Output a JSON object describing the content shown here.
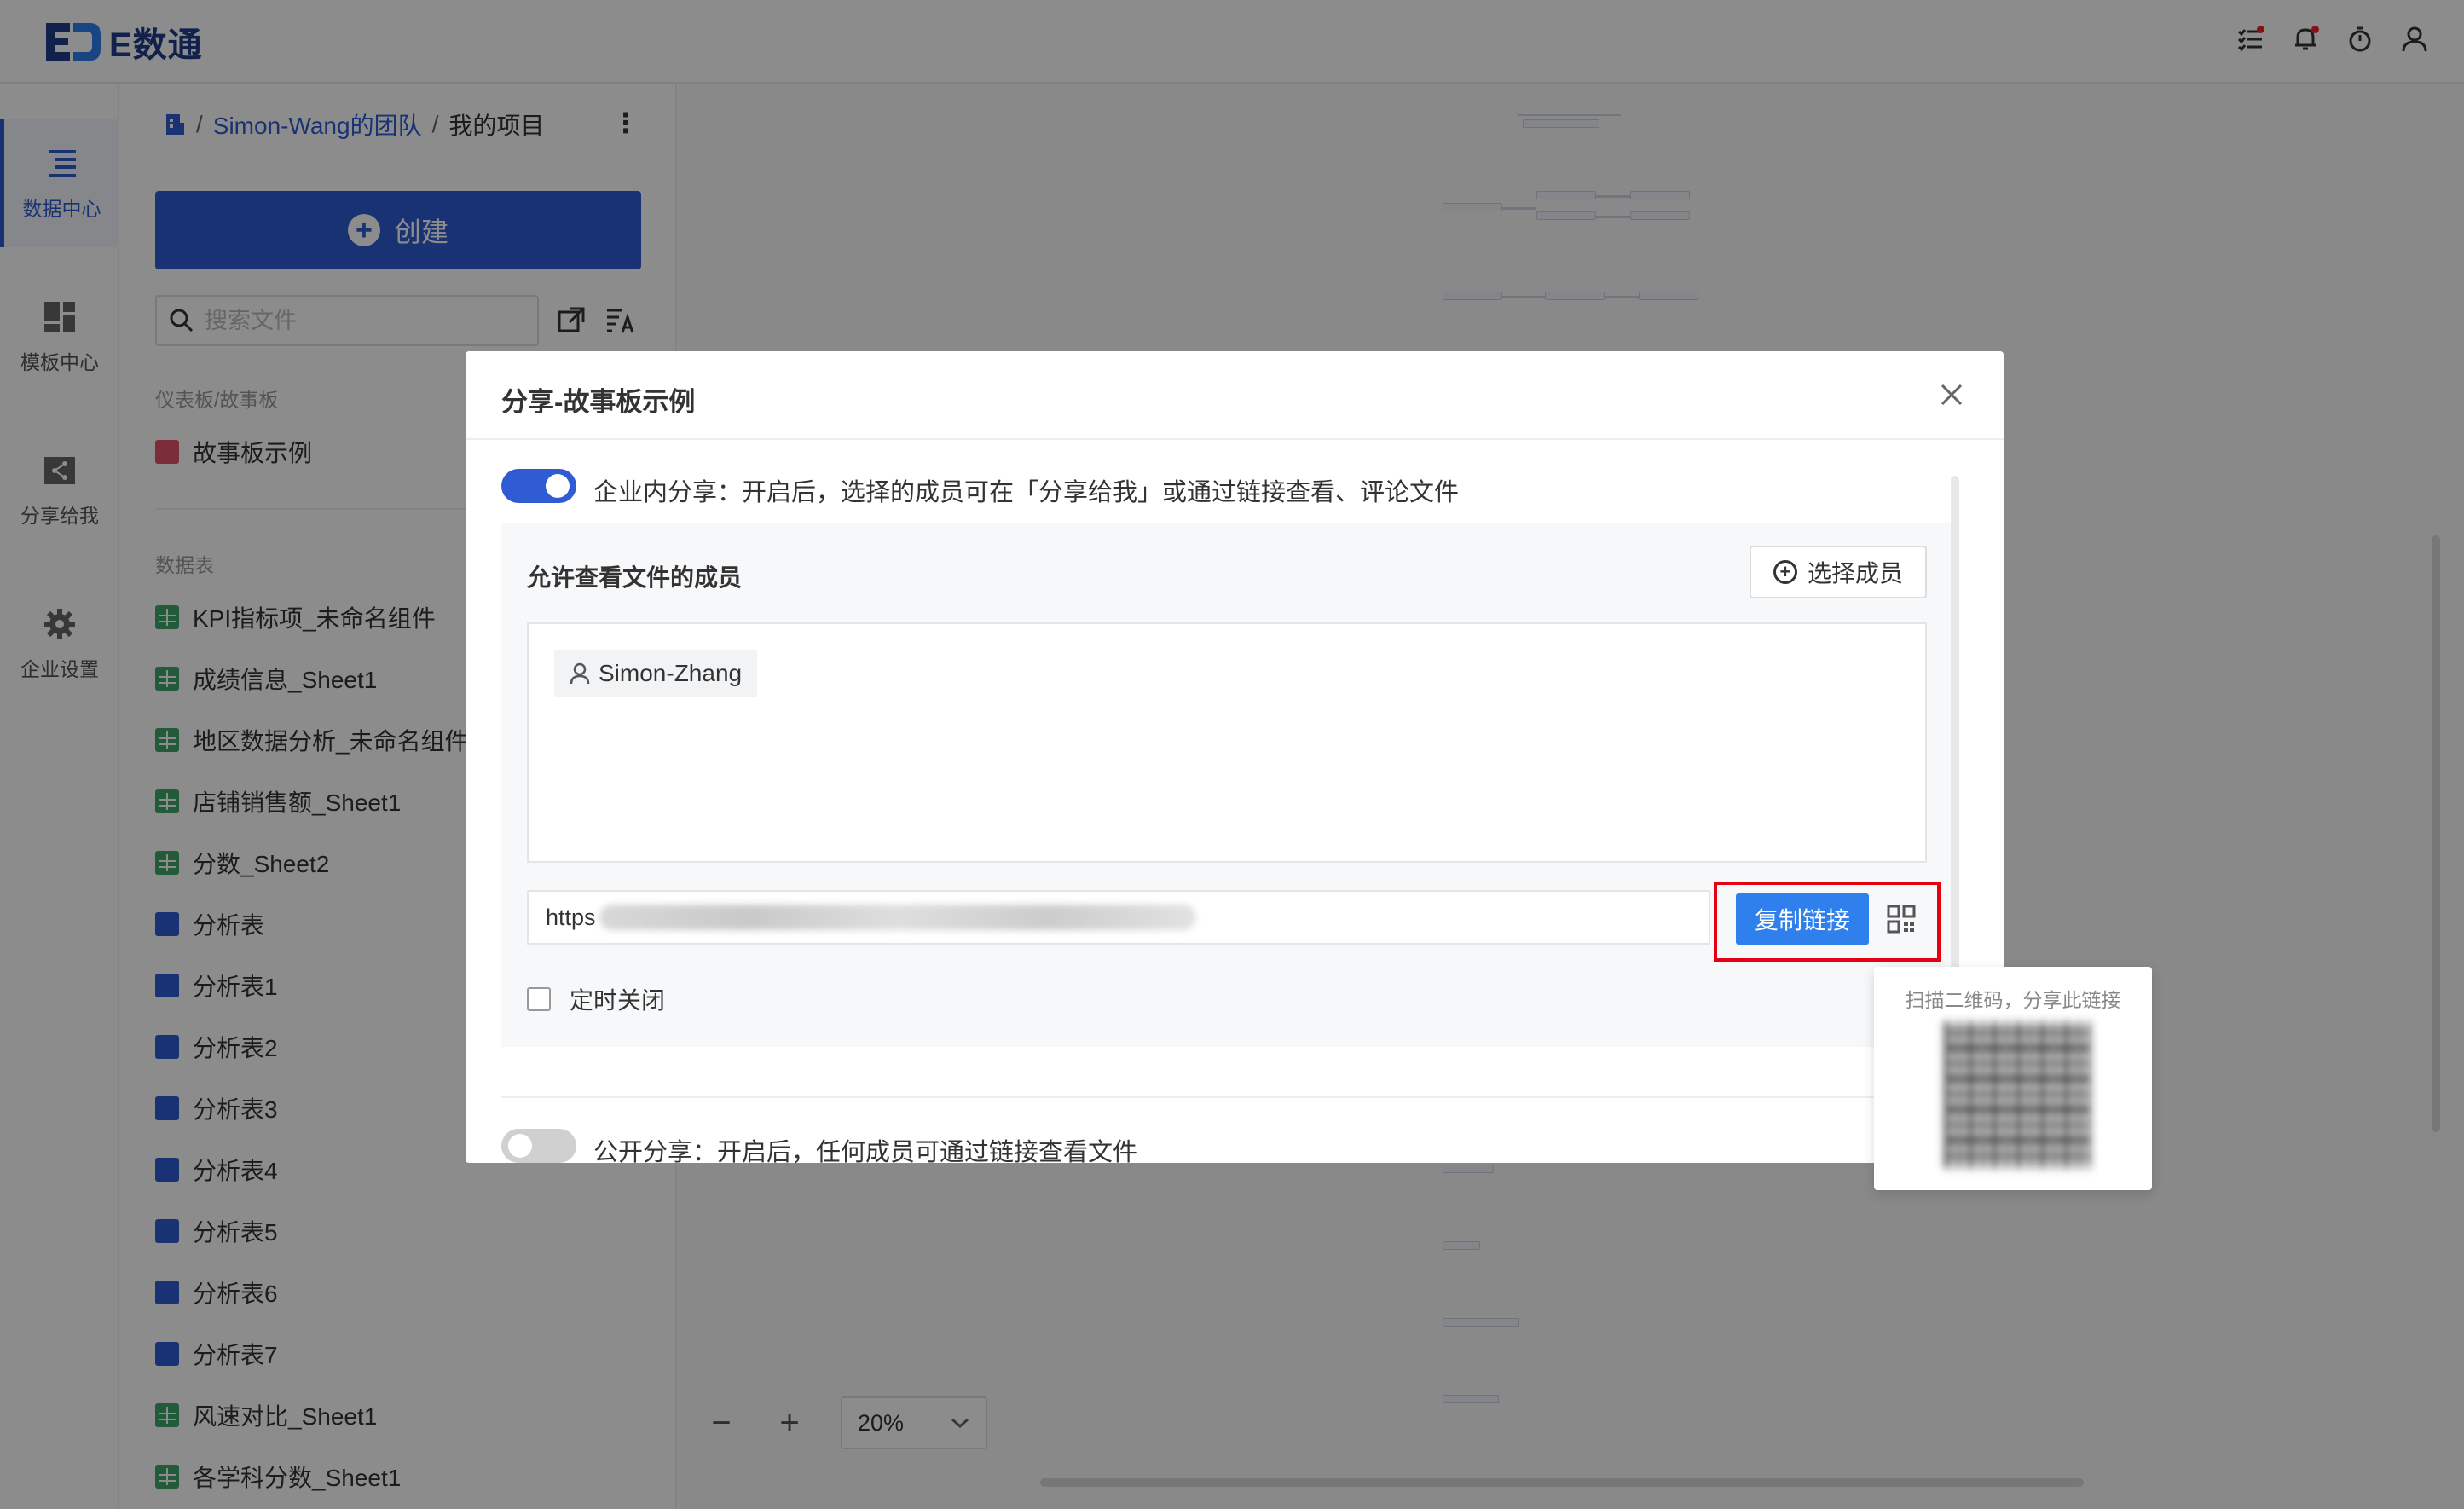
{
  "app": {
    "name": "E数通"
  },
  "leftnav": {
    "items": [
      {
        "label": "数据中心",
        "icon": "data-center-icon",
        "active": true
      },
      {
        "label": "模板中心",
        "icon": "template-icon",
        "active": false
      },
      {
        "label": "分享给我",
        "icon": "share-icon",
        "active": false
      },
      {
        "label": "企业设置",
        "icon": "gear-icon",
        "active": false
      }
    ],
    "help": "?"
  },
  "breadcrumb": {
    "sep": "/",
    "team": "Simon-Wang的团队",
    "current": "我的项目",
    "more": "⋮"
  },
  "filepanel": {
    "create_label": "创建",
    "search_placeholder": "搜索文件",
    "groups": {
      "dashboards": "仪表板/故事板",
      "tables": "数据表"
    },
    "dashboard_items": [
      "故事板示例"
    ],
    "table_items": [
      {
        "name": "KPI指标项_未命名组件",
        "type": "sheet"
      },
      {
        "name": "成绩信息_Sheet1",
        "type": "sheet"
      },
      {
        "name": "地区数据分析_未命名组件",
        "type": "sheet"
      },
      {
        "name": "店铺销售额_Sheet1",
        "type": "sheet"
      },
      {
        "name": "分数_Sheet2",
        "type": "sheet"
      },
      {
        "name": "分析表",
        "type": "analysis"
      },
      {
        "name": "分析表1",
        "type": "analysis"
      },
      {
        "name": "分析表2",
        "type": "analysis"
      },
      {
        "name": "分析表3",
        "type": "analysis"
      },
      {
        "name": "分析表4",
        "type": "analysis"
      },
      {
        "name": "分析表5",
        "type": "analysis"
      },
      {
        "name": "分析表6",
        "type": "analysis"
      },
      {
        "name": "分析表7",
        "type": "analysis"
      },
      {
        "name": "风速对比_Sheet1",
        "type": "sheet"
      },
      {
        "name": "各学科分数_Sheet1",
        "type": "sheet"
      }
    ]
  },
  "canvas": {
    "zoom_minus": "−",
    "zoom_plus": "+",
    "zoom_value": "20%"
  },
  "modal": {
    "title": "分享-故事板示例",
    "internal_share": {
      "enabled": true,
      "label": "企业内分享：开启后，选择的成员可在「分享给我」或通过链接查看、评论文件"
    },
    "members_title": "允许查看文件的成员",
    "select_member_label": "选择成员",
    "members": [
      "Simon-Zhang"
    ],
    "link_prefix": "https",
    "copy_link_label": "复制链接",
    "timed_close_label": "定时关闭",
    "timed_close_checked": false,
    "public_share": {
      "enabled": false,
      "label": "公开分享：开启后，任何成员可通过链接查看文件"
    }
  },
  "qr_popover": {
    "text": "扫描二维码，分享此链接"
  },
  "colors": {
    "primary": "#2f5bd3",
    "copy_button": "#2f80ed",
    "highlight": "#e60012",
    "sheet_icon": "#3fa56b",
    "analysis_icon": "#2f5bd3",
    "story_icon": "#e0556b"
  }
}
